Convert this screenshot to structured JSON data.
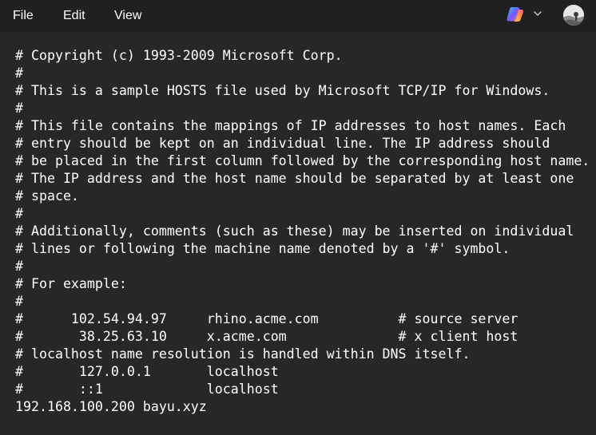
{
  "menu": {
    "file": "File",
    "edit": "Edit",
    "view": "View"
  },
  "toolbar_icons": [
    "copilot-icon",
    "chevron-down-icon",
    "avatar"
  ],
  "colors": {
    "menubar_bg": "#202020",
    "editor_bg": "#272727",
    "text": "#ffffff"
  },
  "editor": {
    "lines": [
      "# Copyright (c) 1993-2009 Microsoft Corp.",
      "#",
      "# This is a sample HOSTS file used by Microsoft TCP/IP for Windows.",
      "#",
      "# This file contains the mappings of IP addresses to host names. Each",
      "# entry should be kept on an individual line. The IP address should",
      "# be placed in the first column followed by the corresponding host name.",
      "# The IP address and the host name should be separated by at least one",
      "# space.",
      "#",
      "# Additionally, comments (such as these) may be inserted on individual",
      "# lines or following the machine name denoted by a '#' symbol.",
      "#",
      "# For example:",
      "#",
      "#      102.54.94.97     rhino.acme.com          # source server",
      "#       38.25.63.10     x.acme.com              # x client host",
      "# localhost name resolution is handled within DNS itself.",
      "#       127.0.0.1       localhost",
      "#       ::1             localhost",
      "192.168.100.200 bayu.xyz"
    ]
  }
}
